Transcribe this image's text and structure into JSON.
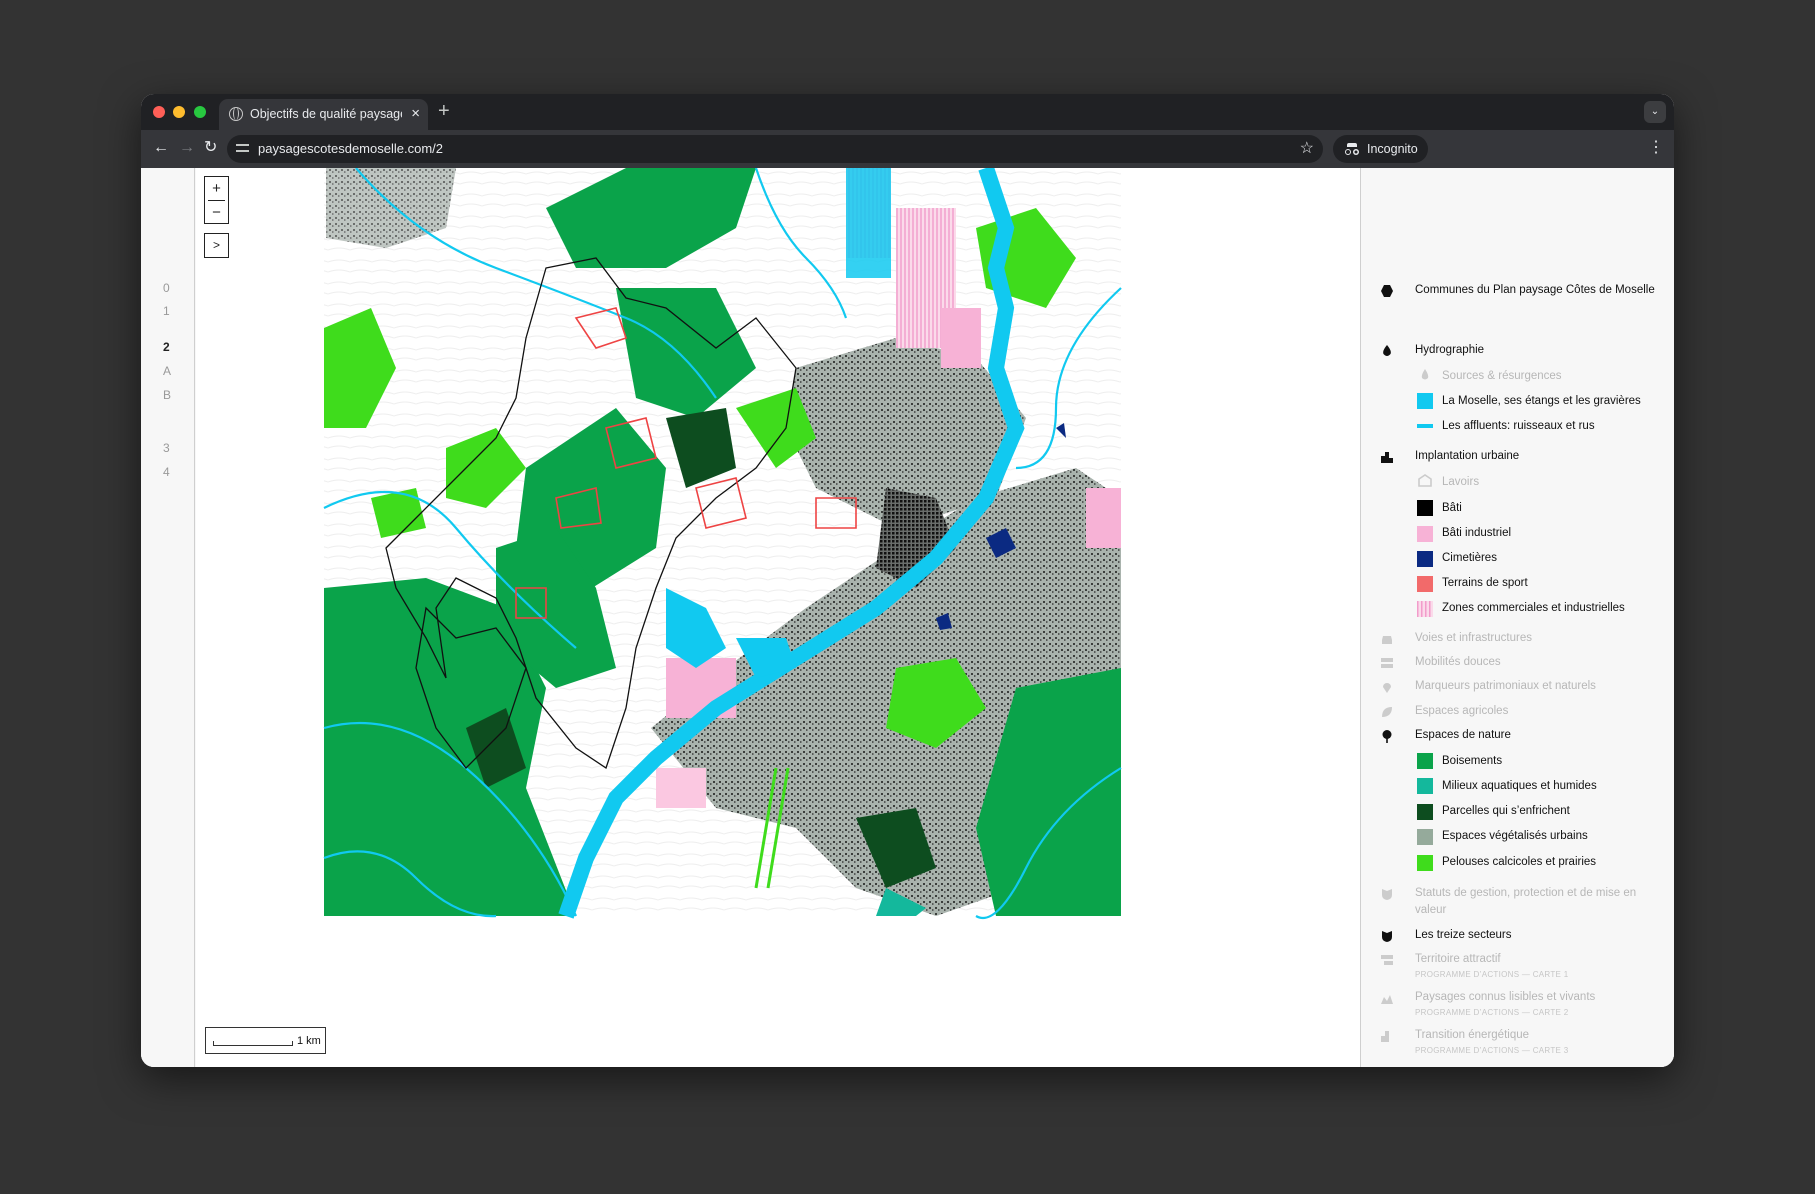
{
  "browser": {
    "tab_title": "Objectifs de qualité paysagère",
    "tab_close": "×",
    "new_tab": "+",
    "tab_search": "⌄",
    "url": "paysagescotesdemoselle.com/2",
    "incognito_label": "Incognito",
    "back": "←",
    "forward": "→",
    "reload": "↻",
    "star": "☆",
    "menu": "⋮"
  },
  "section_nav": [
    "0",
    "1",
    "2",
    "A",
    "B",
    "3",
    "4"
  ],
  "section_nav_active": "2",
  "map": {
    "zoom_in": "+",
    "zoom_out": "−",
    "expand": ">",
    "scale_label": "1 km"
  },
  "legend": {
    "communes": "Communes du Plan paysage Côtes de Moselle",
    "hydrographie": {
      "title": "Hydrographie",
      "items": [
        {
          "label": "Sources & résurgences",
          "dimmed": true,
          "icon": "drop-icon"
        },
        {
          "label": "La Moselle, ses étangs et les gravières",
          "color": "#11c9f0"
        },
        {
          "label": "Les affluents: ruisseaux et rus",
          "color": "#11c9f0",
          "style": "line"
        }
      ]
    },
    "implantation": {
      "title": "Implantation urbaine",
      "items": [
        {
          "label": "Lavoirs",
          "dimmed": true,
          "icon": "lavoir-icon"
        },
        {
          "label": "Bâti",
          "color": "#000000"
        },
        {
          "label": "Bâti industriel",
          "color": "#f7b2d6"
        },
        {
          "label": "Cimetières",
          "color": "#0b2a82"
        },
        {
          "label": "Terrains de sport",
          "color": "#f26a6a"
        },
        {
          "label": "Zones commerciales et industrielles",
          "color": "#f7b2d6",
          "style": "hatch"
        }
      ]
    },
    "dim_groups": [
      {
        "label": "Voies et infrastructures",
        "icon": "car-icon"
      },
      {
        "label": "Mobilités douces",
        "icon": "signpost-icon"
      },
      {
        "label": "Marqueurs patrimoniaux et naturels",
        "icon": "pin-icon"
      },
      {
        "label": "Espaces agricoles",
        "icon": "leaf-icon"
      }
    ],
    "nature": {
      "title": "Espaces de nature",
      "items": [
        {
          "label": "Boisements",
          "color": "#0aa34a"
        },
        {
          "label": "Milieux aquatiques et humides",
          "color": "#14b89c"
        },
        {
          "label": "Parcelles qui s’enfrichent",
          "color": "#0d4d1f"
        },
        {
          "label": "Espaces végétalisés urbains",
          "color": "#95aa9b"
        },
        {
          "label": "Pelouses calcicoles et prairies",
          "color": "#3fdc1c"
        }
      ]
    },
    "statuts": "Statuts de gestion, protection et de mise en valeur",
    "secteurs": "Les treize secteurs",
    "programmes": [
      {
        "label": "Territoire attractif",
        "caption": "PROGRAMME D’ACTIONS — CARTE 1"
      },
      {
        "label": "Paysages connus lisibles et vivants",
        "caption": "PROGRAMME D’ACTIONS — CARTE 2"
      },
      {
        "label": "Transition énergétique",
        "caption": "PROGRAMME D’ACTIONS — CARTE 3"
      }
    ]
  }
}
